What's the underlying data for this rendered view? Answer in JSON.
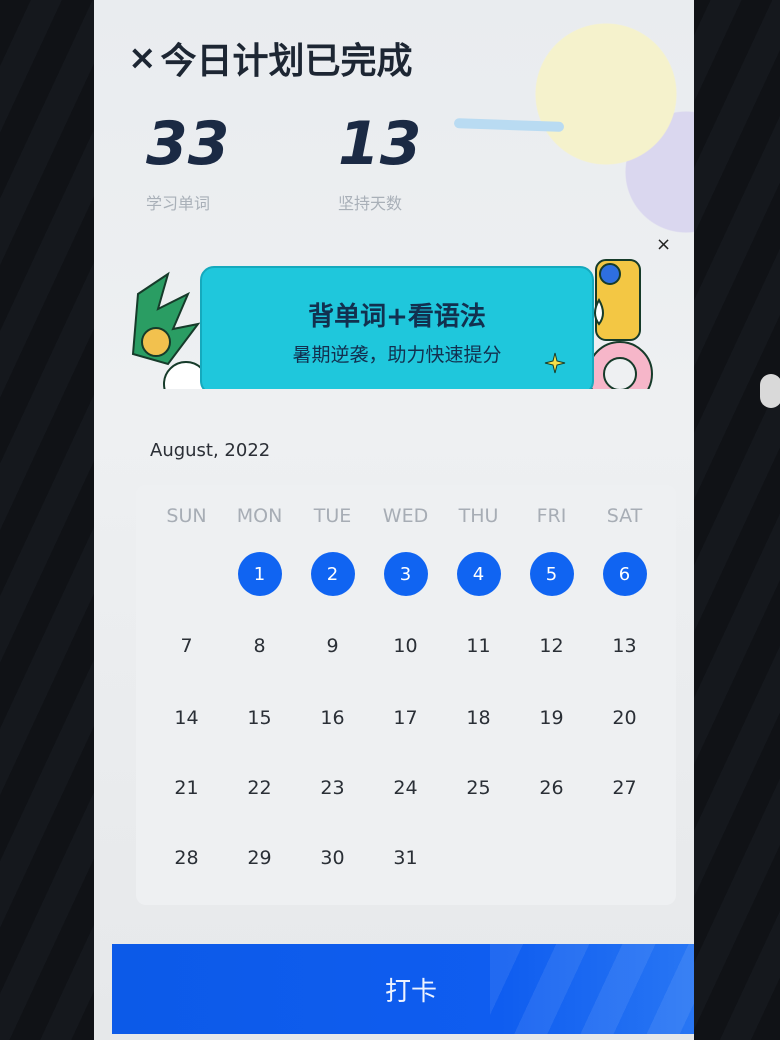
{
  "header": {
    "close_symbol": "×",
    "title": "今日计划已完成"
  },
  "stats": [
    {
      "value": "33",
      "label": "学习单词"
    },
    {
      "value": "13",
      "label": "坚持天数"
    }
  ],
  "banner": {
    "close_symbol": "×",
    "title": "背单词+看语法",
    "subtitle": "暑期逆袭，助力快速提分"
  },
  "calendar": {
    "month_label": "August, 2022",
    "weekdays": [
      "SUN",
      "MON",
      "TUE",
      "WED",
      "THU",
      "FRI",
      "SAT"
    ],
    "weeks": [
      [
        "",
        "1",
        "2",
        "3",
        "4",
        "5",
        "6"
      ],
      [
        "7",
        "8",
        "9",
        "10",
        "11",
        "12",
        "13"
      ],
      [
        "14",
        "15",
        "16",
        "17",
        "18",
        "19",
        "20"
      ],
      [
        "21",
        "22",
        "23",
        "24",
        "25",
        "26",
        "27"
      ],
      [
        "28",
        "29",
        "30",
        "31",
        "",
        "",
        ""
      ]
    ],
    "checked_days": [
      "1",
      "2",
      "3",
      "4",
      "5",
      "6"
    ],
    "checked_color": "#1064f2"
  },
  "checkin_button": {
    "label": "打卡"
  },
  "colors": {
    "accent": "#1064f2",
    "banner_bg": "#1fc7dc",
    "title_text": "#1d2633"
  }
}
